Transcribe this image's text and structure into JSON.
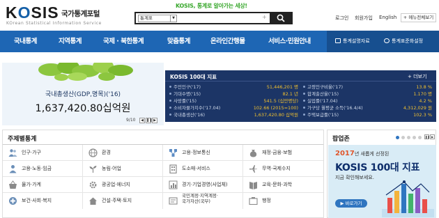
{
  "header": {
    "logo_word_k": "K",
    "logo_word_o": "O",
    "logo_word_rest": "SIS",
    "logo_kr": "국가통계포털",
    "logo_en": "KOrean Statistical Information Service",
    "slogan": "KOSIS, 통계로 알아가는 세상!",
    "search_select": "통계표",
    "search_plus": "+",
    "util_login": "로그인",
    "util_join": "회원가입",
    "util_english": "English",
    "sitemap": "메뉴전체보기"
  },
  "nav": {
    "items": [
      "국내통계",
      "지역통계",
      "국제 · 북한통계",
      "맞춤통계",
      "온라인간행물",
      "서비스·민원안내"
    ],
    "right_items": [
      "통계설명자료",
      "통계표준화설정"
    ]
  },
  "banner": {
    "label": "국내총생산(GDP,명목)('16)",
    "value": "1,637,420.80십억원",
    "page": "9/10"
  },
  "indicators": {
    "title": "KOSIS 100대 지표",
    "more": "+ 더보기",
    "left": [
      {
        "name": "주민인구('17)",
        "value": "51,446,201 명"
      },
      {
        "name": "기대수명('15)",
        "value": "82.1 년"
      },
      {
        "name": "사망률('15)",
        "value": "541.5 (십만명당)"
      },
      {
        "name": "소비자물가지수('17.04)",
        "value": "102.66 (2015=100)"
      },
      {
        "name": "국내총생산('16)",
        "value": "1,637,420.80 십억원"
      }
    ],
    "right": [
      {
        "name": "고령인구비율('17)",
        "value": "13.8 %"
      },
      {
        "name": "합계출산율('15)",
        "value": "1.170 명"
      },
      {
        "name": "실업률('17.04)",
        "value": "4.2 %"
      },
      {
        "name": "가구당 월평균 소득('16.4/4)",
        "value": "4,312,029 원"
      },
      {
        "name": "주택보급률('15)",
        "value": "102.3 %"
      }
    ]
  },
  "topics": {
    "title": "주제별통계",
    "items": [
      {
        "label": "인구·가구",
        "icon": "people-icon"
      },
      {
        "label": "환경",
        "icon": "globe-icon"
      },
      {
        "label": "고용·정보통신",
        "icon": "network-icon"
      },
      {
        "label": "재정·금융·보험",
        "icon": "money-bag-icon"
      },
      {
        "label": "고용·노동·임금",
        "icon": "worker-icon"
      },
      {
        "label": "농림·어업",
        "icon": "sprout-icon"
      },
      {
        "label": "도소매·서비스",
        "icon": "building-icon"
      },
      {
        "label": "무역·국제수지",
        "icon": "airplane-icon"
      },
      {
        "label": "물가·가계",
        "icon": "basket-icon"
      },
      {
        "label": "광공업·에너지",
        "icon": "gear-icon"
      },
      {
        "label": "경기·기업경영(사업체)",
        "icon": "chart-icon"
      },
      {
        "label": "교육·문화·과학",
        "icon": "book-icon"
      },
      {
        "label": "보건·사회·복지",
        "icon": "health-icon"
      },
      {
        "label": "건설·주택·토지",
        "icon": "house-icon"
      },
      {
        "label": "국민계정·지역계정·국가자산(국부)",
        "label_line1": "국민계정·지역계정·",
        "label_line2": "국가자산(국부)",
        "icon": "account-icon"
      },
      {
        "label": "행정",
        "icon": "admin-icon"
      }
    ]
  },
  "popup": {
    "title": "팝업존",
    "year_label": "년 새롭게 선정된",
    "year": "2017",
    "main": "KOSIS 100대 지표",
    "sub": "지금 확인해보세요.",
    "button": "▶ 바로가기"
  },
  "colors": {
    "nav_blue": "#1e66b4",
    "indicator_bg": "#1c3566",
    "indicator_value": "#f0c030",
    "slogan_green": "#3aa82e"
  }
}
